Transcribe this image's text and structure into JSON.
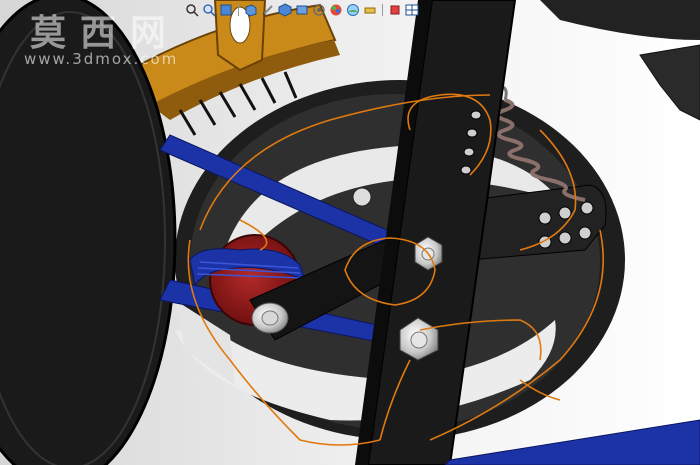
{
  "watermark": {
    "chinese": "莫西网",
    "url": "www.3dmox.com"
  },
  "toolbar": {
    "items": [
      {
        "icon": "zoom-to-fit-icon"
      },
      {
        "icon": "zoom-area-icon"
      },
      {
        "icon": "previous-view-icon"
      },
      {
        "icon": "section-view-icon"
      },
      {
        "icon": "dynamic-annotation-icon"
      },
      {
        "icon": "view-orientation-icon"
      },
      {
        "icon": "display-style-icon"
      },
      {
        "icon": "hide-show-items-icon"
      },
      {
        "icon": "edit-appearance-icon"
      },
      {
        "icon": "apply-scene-icon"
      },
      {
        "icon": "view-settings-icon"
      },
      {
        "icon": "window-restore-icon"
      },
      {
        "icon": "window-tile-icon"
      }
    ]
  },
  "colors": {
    "frame_black": "#1a1a1a",
    "disc_gray": "#2b2b2b",
    "belt_blue": "#1c33a8",
    "pulley_red": "#9c1818",
    "wheel_orange": "#c98a1a",
    "sketch_orange": "#e07a10"
  }
}
